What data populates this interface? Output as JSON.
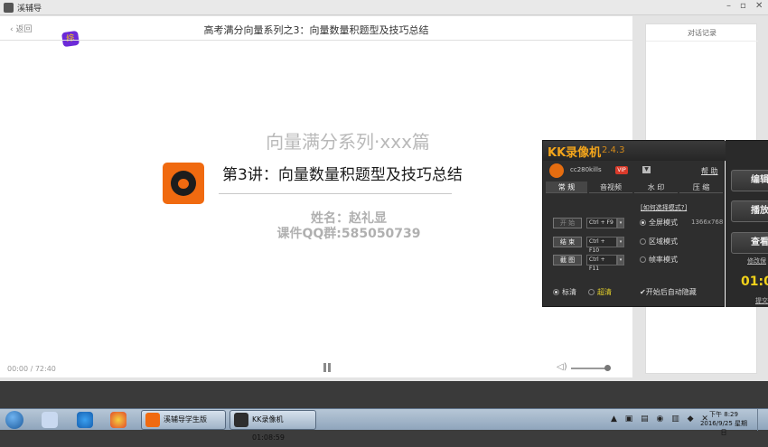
{
  "window": {
    "title": "溪辅导",
    "controls": [
      "–",
      "▫",
      "✕"
    ]
  },
  "header": {
    "back_label": "返回",
    "course_title": "高考满分向量系列之3：向量数量积题型及技巧总结"
  },
  "sticker": {
    "text": "综"
  },
  "slide": {
    "series_title": "向量满分系列·xxx篇",
    "lecture_title": "第3讲：向量数量积题型及技巧总结",
    "teacher": "姓名：赵礼显",
    "qq_group": "课件QQ群:585050739"
  },
  "player": {
    "time": "00:00 / 72:40",
    "volume_level": 1.0
  },
  "chat": {
    "title": "对话记录"
  },
  "kk": {
    "title": "KK录像机",
    "version": "2.4.3",
    "user": "cc280kills",
    "vip": "VIP",
    "help": "帮 助",
    "tabs": [
      "常 规",
      "音视频",
      "水 印",
      "压 缩"
    ],
    "mode_link": "[如何选择模式?]",
    "buttons": [
      {
        "label": "开 始",
        "hotkey": "Ctrl + F9"
      },
      {
        "label": "结 束",
        "hotkey": "Ctrl + F10"
      },
      {
        "label": "截 图",
        "hotkey": "Ctrl + F11"
      }
    ],
    "modes": [
      "全屏模式",
      "区域模式",
      "帧率模式"
    ],
    "resolution": "1366x768",
    "quality": [
      "标清",
      "超清"
    ],
    "auto_hide": "开始后自动隐藏",
    "side_buttons": [
      "编辑",
      "播放",
      "查看"
    ],
    "timer": "01:0",
    "side_links": [
      "修改保",
      "提交"
    ]
  },
  "taskbar": {
    "items": [
      "溪辅导学生版",
      "KK录像机 01:08:59"
    ],
    "clock_time": "下午 8:29",
    "clock_date": "2016/9/25 星期日"
  }
}
